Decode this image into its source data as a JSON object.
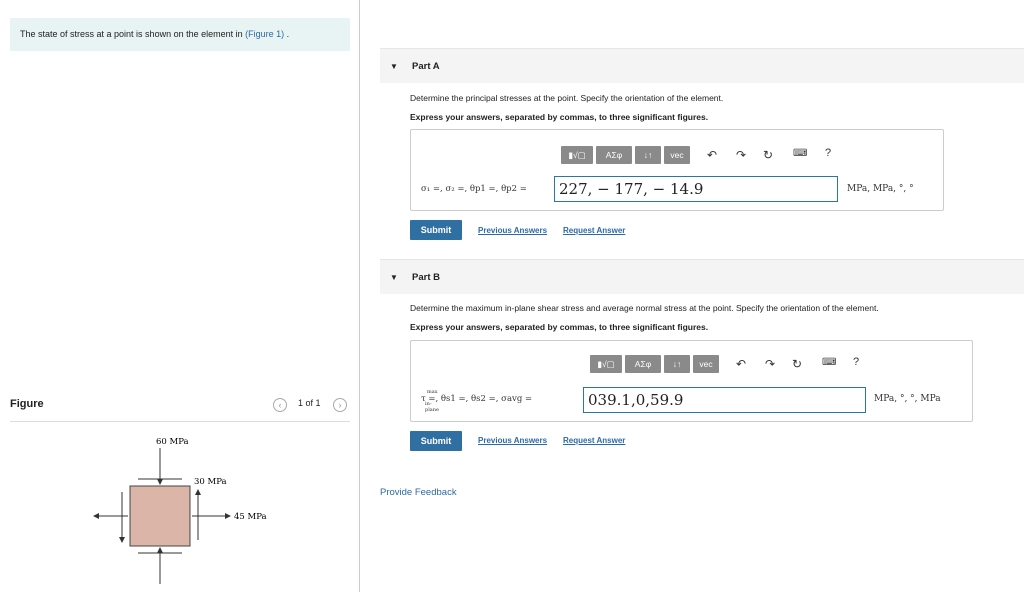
{
  "problem": {
    "text": "The state of stress at a point is shown on the element in ",
    "link": "(Figure 1)",
    "suffix": " ."
  },
  "figure": {
    "label": "Figure",
    "pager": "1 of 1",
    "prev_icon": "chevron-left-icon",
    "next_icon": "chevron-right-icon",
    "stress_top": "60 MPa",
    "stress_shear": "30 MPa",
    "stress_side": "45 MPa",
    "element_color": "#dbb5a8"
  },
  "partA": {
    "title": "Part A",
    "question": "Determine the principal stresses at the point. Specify the orientation of the element.",
    "instruction": "Express your answers, separated by commas, to three significant figures.",
    "toolbar": {
      "templates": "▮√▢",
      "greek": "ΑΣφ",
      "arrows": "↓↑",
      "vec": "vec",
      "help": "?"
    },
    "variables": "σ₁ =, σ₂ =, θp1 =, θp2 =",
    "answer": "227, − 177, − 14.9",
    "units": "MPa, MPa, °, °",
    "submit": "Submit",
    "previous_answers": "Previous Answers",
    "request_answer": "Request Answer"
  },
  "partB": {
    "title": "Part B",
    "question": "Determine the maximum in-plane shear stress and average normal stress at the point. Specify the orientation of the element.",
    "instruction": "Express your answers, separated by commas, to three significant figures.",
    "toolbar": {
      "templates": "▮√▢",
      "greek": "ΑΣφ",
      "arrows": "↓↑",
      "vec": "vec",
      "help": "?"
    },
    "variables": "τ =, θs1 =, θs2 =, σavg =",
    "tau_sup": "max",
    "tau_sub": "in-plane",
    "answer": "039.1,0,59.9",
    "units": "MPa, °, °, MPa",
    "submit": "Submit",
    "previous_answers": "Previous Answers",
    "request_answer": "Request Answer"
  },
  "feedback": "Provide Feedback",
  "colors": {
    "accent": "#2f6fa1",
    "link": "#2b6aa6",
    "toolbar": "#8a8a8a"
  }
}
